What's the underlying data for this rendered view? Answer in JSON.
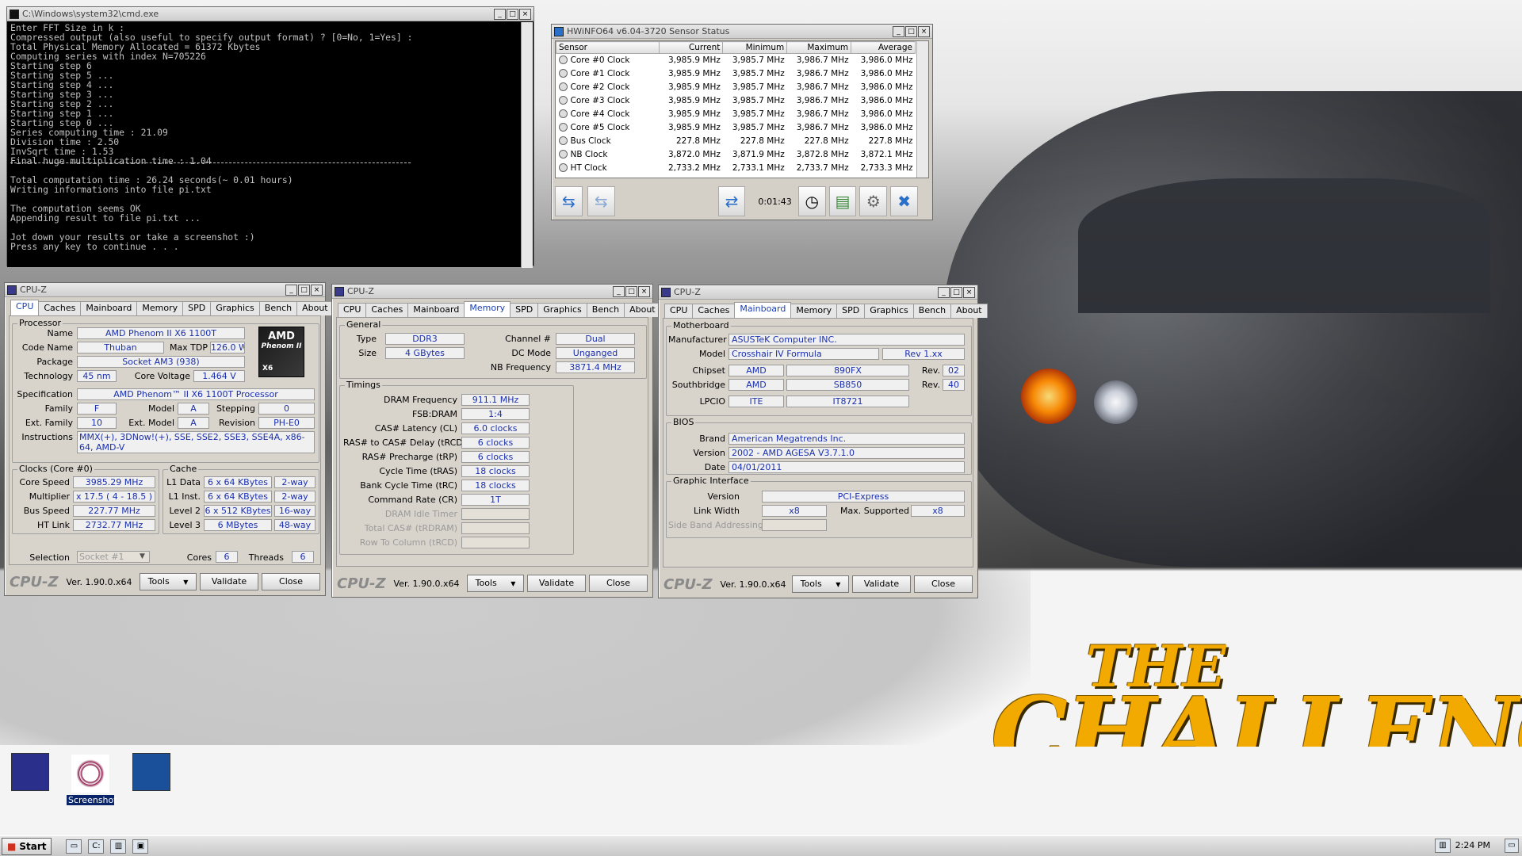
{
  "cmd": {
    "title": "C:\\Windows\\system32\\cmd.exe",
    "lines": [
      "Enter FFT Size in k :",
      "Compressed output (also useful to specify output format) ? [0=No, 1=Yes] :",
      "Total Physical Memory Allocated = 61372 Kbytes",
      "Computing series with index N=705226",
      "Starting step 6",
      "Starting step 5 ...",
      "Starting step 4 ...",
      "Starting step 3 ...",
      "Starting step 2 ...",
      "Starting step 1 ...",
      "Starting step 0 ...",
      "Series computing time : 21.09",
      "Division time : 2.50",
      "InvSqrt time : 1.53",
      "Final huge multiplication time : 1.04",
      "",
      "Total computation time : 26.24 seconds(~ 0.01 hours)",
      "Writing informations into file pi.txt",
      "",
      "The computation seems OK",
      "Appending result to file pi.txt ...",
      "",
      "Jot down your results or take a screenshot :)",
      "Press any key to continue . . ."
    ]
  },
  "hwinfo": {
    "title": "HWiNFO64 v6.04-3720 Sensor Status",
    "headers": [
      "Sensor",
      "Current",
      "Minimum",
      "Maximum",
      "Average"
    ],
    "rows": [
      [
        "Core #0 Clock",
        "3,985.9 MHz",
        "3,985.7 MHz",
        "3,986.7 MHz",
        "3,986.0 MHz"
      ],
      [
        "Core #1 Clock",
        "3,985.9 MHz",
        "3,985.7 MHz",
        "3,986.7 MHz",
        "3,986.0 MHz"
      ],
      [
        "Core #2 Clock",
        "3,985.9 MHz",
        "3,985.7 MHz",
        "3,986.7 MHz",
        "3,986.0 MHz"
      ],
      [
        "Core #3 Clock",
        "3,985.9 MHz",
        "3,985.7 MHz",
        "3,986.7 MHz",
        "3,986.0 MHz"
      ],
      [
        "Core #4 Clock",
        "3,985.9 MHz",
        "3,985.7 MHz",
        "3,986.7 MHz",
        "3,986.0 MHz"
      ],
      [
        "Core #5 Clock",
        "3,985.9 MHz",
        "3,985.7 MHz",
        "3,986.7 MHz",
        "3,986.0 MHz"
      ],
      [
        "Bus Clock",
        "227.8 MHz",
        "227.8 MHz",
        "227.8 MHz",
        "227.8 MHz"
      ],
      [
        "NB Clock",
        "3,872.0 MHz",
        "3,871.9 MHz",
        "3,872.8 MHz",
        "3,872.1 MHz"
      ],
      [
        "HT Clock",
        "2,733.2 MHz",
        "2,733.1 MHz",
        "2,733.7 MHz",
        "2,733.3 MHz"
      ]
    ],
    "timer": "0:01:43"
  },
  "cpuz": {
    "title": "CPU-Z",
    "tabs": [
      "CPU",
      "Caches",
      "Mainboard",
      "Memory",
      "SPD",
      "Graphics",
      "Bench",
      "About"
    ],
    "logo": "CPU-Z",
    "version": "Ver. 1.90.0.x64",
    "tools": "Tools",
    "validate": "Validate",
    "close": "Close"
  },
  "cpu": {
    "g_proc": "Processor",
    "name_l": "Name",
    "name": "AMD Phenom II X6 1100T",
    "code_l": "Code Name",
    "code": "Thuban",
    "tdp_l": "Max TDP",
    "tdp": "126.0 W",
    "pkg_l": "Package",
    "pkg": "Socket AM3 (938)",
    "tech_l": "Technology",
    "tech": "45 nm",
    "cv_l": "Core Voltage",
    "cv": "1.464 V",
    "spec_l": "Specification",
    "spec": "AMD Phenom™ II X6 1100T Processor",
    "fam_l": "Family",
    "fam": "F",
    "mod_l": "Model",
    "mod": "A",
    "step_l": "Stepping",
    "step": "0",
    "efam_l": "Ext. Family",
    "efam": "10",
    "emod_l": "Ext. Model",
    "emod": "A",
    "rev_l": "Revision",
    "rev": "PH-E0",
    "ins_l": "Instructions",
    "ins": "MMX(+), 3DNow!(+), SSE, SSE2, SSE3, SSE4A, x86-64, AMD-V",
    "g_clk": "Clocks (Core #0)",
    "cs_l": "Core Speed",
    "cs": "3985.29 MHz",
    "mul_l": "Multiplier",
    "mul": "x 17.5 ( 4 - 18.5 )",
    "bs_l": "Bus Speed",
    "bs": "227.77 MHz",
    "ht_l": "HT Link",
    "ht": "2732.77 MHz",
    "g_cache": "Cache",
    "l1d_l": "L1 Data",
    "l1d": "6 x 64 KBytes",
    "l1d_w": "2-way",
    "l1i_l": "L1 Inst.",
    "l1i": "6 x 64 KBytes",
    "l1i_w": "2-way",
    "l2_l": "Level 2",
    "l2": "6 x 512 KBytes",
    "l2_w": "16-way",
    "l3_l": "Level 3",
    "l3": "6 MBytes",
    "l3_w": "48-way",
    "sel_l": "Selection",
    "sel": "Socket #1",
    "cores_l": "Cores",
    "cores": "6",
    "thr_l": "Threads",
    "thr": "6",
    "amd_brand": "AMD",
    "amd_sub": "Phenom II",
    "amd_x": "X6"
  },
  "mem": {
    "g_gen": "General",
    "type_l": "Type",
    "type": "DDR3",
    "size_l": "Size",
    "size": "4 GBytes",
    "ch_l": "Channel #",
    "ch": "Dual",
    "dc_l": "DC Mode",
    "dc": "Unganged",
    "nb_l": "NB Frequency",
    "nb": "3871.4 MHz",
    "g_tim": "Timings",
    "t": [
      [
        "DRAM Frequency",
        "911.1 MHz"
      ],
      [
        "FSB:DRAM",
        "1:4"
      ],
      [
        "CAS# Latency (CL)",
        "6.0 clocks"
      ],
      [
        "RAS# to CAS# Delay (tRCD)",
        "6 clocks"
      ],
      [
        "RAS# Precharge (tRP)",
        "6 clocks"
      ],
      [
        "Cycle Time (tRAS)",
        "18 clocks"
      ],
      [
        "Bank Cycle Time (tRC)",
        "18 clocks"
      ],
      [
        "Command Rate (CR)",
        "1T"
      ],
      [
        "DRAM Idle Timer",
        ""
      ],
      [
        "Total CAS# (tRDRAM)",
        ""
      ],
      [
        "Row To Column (tRCD)",
        ""
      ]
    ]
  },
  "mb": {
    "g_mb": "Motherboard",
    "man_l": "Manufacturer",
    "man": "ASUSTeK Computer INC.",
    "model_l": "Model",
    "model": "Crosshair IV Formula",
    "model_rev": "Rev 1.xx",
    "chip_l": "Chipset",
    "chip": "AMD",
    "chip2": "890FX",
    "rev_l": "Rev.",
    "chip_rev": "02",
    "sb_l": "Southbridge",
    "sb": "AMD",
    "sb2": "SB850",
    "sb_rev": "40",
    "lpc_l": "LPCIO",
    "lpc": "ITE",
    "lpc2": "IT8721",
    "g_bios": "BIOS",
    "brand_l": "Brand",
    "brand": "American Megatrends Inc.",
    "ver_l": "Version",
    "ver": "2002 - AMD AGESA V3.7.1.0",
    "date_l": "Date",
    "date": "04/01/2011",
    "g_gi": "Graphic Interface",
    "gv_l": "Version",
    "gv": "PCI-Express",
    "lw_l": "Link Width",
    "lw": "x8",
    "ms_l": "Max. Supported",
    "ms": "x8",
    "sba_l": "Side Band Addressing"
  },
  "wall": {
    "line1": "THE",
    "line2": "CHALLENGERS"
  },
  "desktop": {
    "icon2_label": "Screenshot"
  },
  "taskbar": {
    "start": "Start",
    "time": "2:24 PM"
  }
}
